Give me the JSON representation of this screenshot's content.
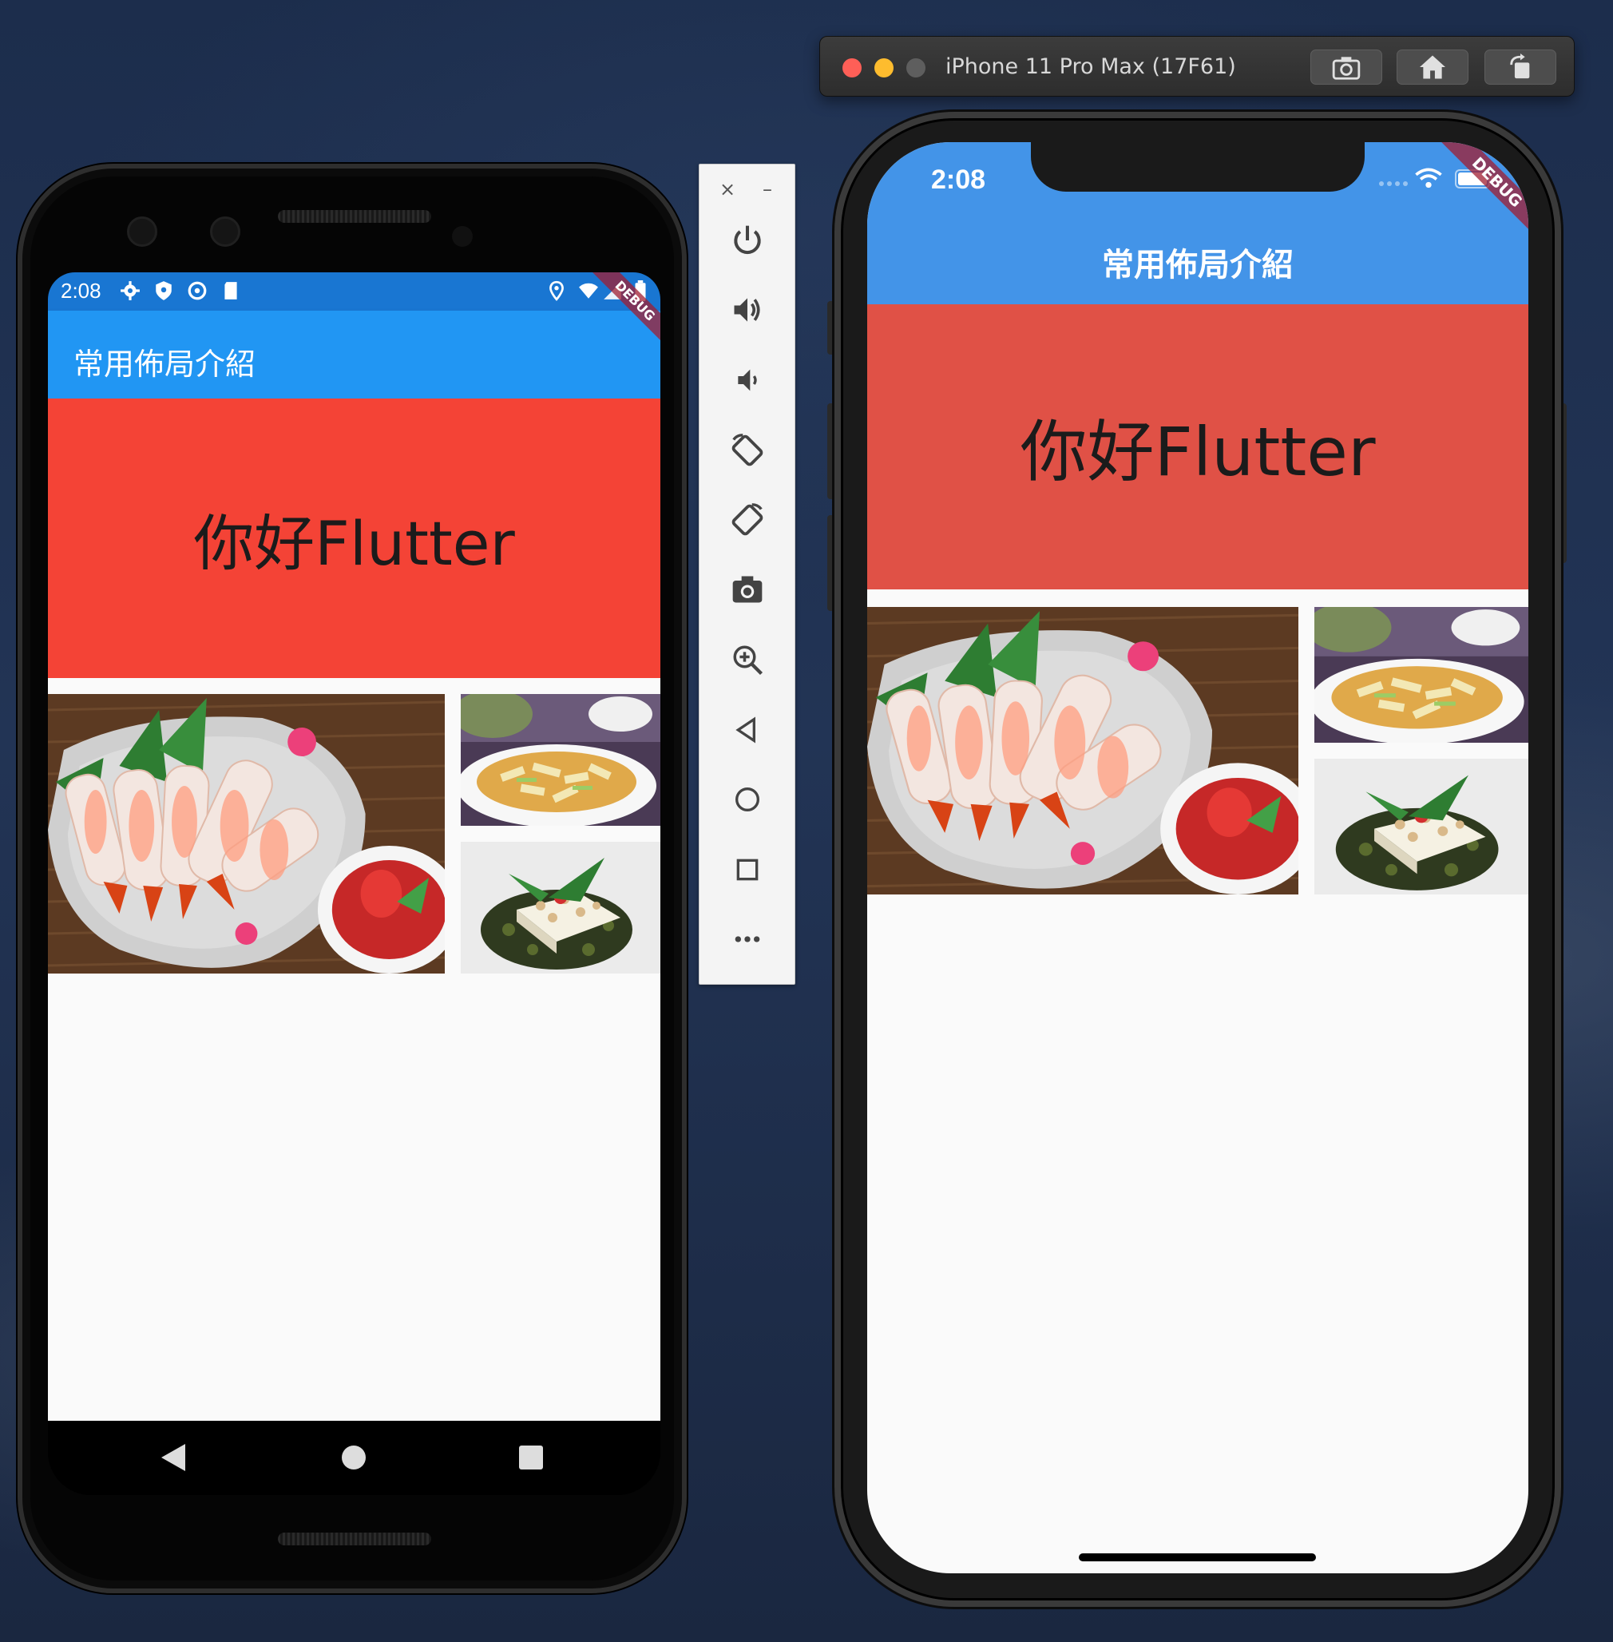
{
  "android": {
    "status_time": "2:08",
    "app_title": "常用佈局介紹",
    "hello_text": "你好Flutter",
    "debug_banner": "DEBUG"
  },
  "emulator_toolbar": {
    "close_label": "×",
    "minimize_label": "–",
    "more_label": "•••"
  },
  "simulator": {
    "window_title": "iPhone 11 Pro Max (17F61)",
    "status_time": "2:08",
    "app_title": "常用佈局介紹",
    "hello_text": "你好Flutter",
    "debug_banner": "DEBUG"
  },
  "colors": {
    "android_status": "#1976d2",
    "android_appbar": "#2196f3",
    "android_hello_bg": "#f44336",
    "ios_header": "#4394e8",
    "ios_hello_bg": "#e05146",
    "body_bg": "#fafafa"
  },
  "icons": {
    "android_status_left": [
      "settings-icon",
      "shield-icon",
      "sync-icon",
      "sd-card-icon"
    ],
    "android_status_right": [
      "location-icon",
      "wifi-icon",
      "signal-icon",
      "battery-icon"
    ],
    "toolbar": [
      "power-icon",
      "volume-up-icon",
      "volume-down-icon",
      "rotate-left-icon",
      "rotate-right-icon",
      "camera-icon",
      "zoom-icon",
      "back-icon",
      "home-icon",
      "overview-icon",
      "more-icon"
    ],
    "sim_buttons": [
      "screenshot-icon",
      "home-icon",
      "rotate-icon"
    ]
  }
}
